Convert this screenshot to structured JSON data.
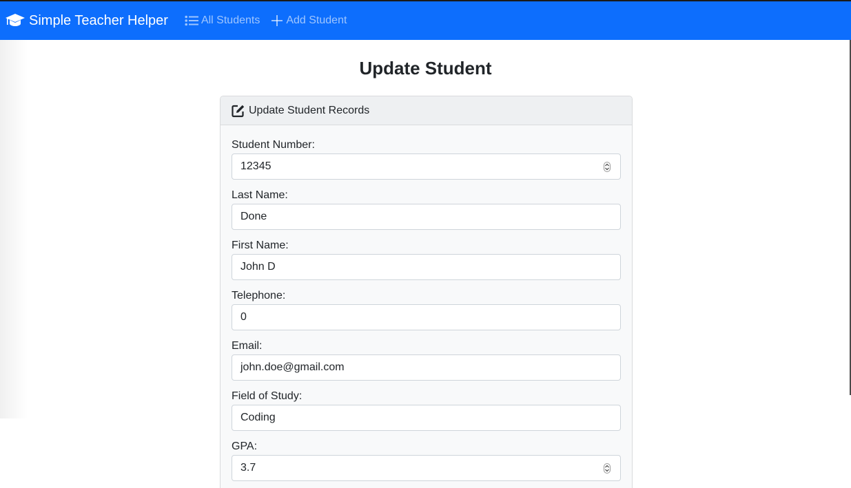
{
  "navbar": {
    "brand": "Simple Teacher Helper",
    "links": [
      {
        "label": "All Students",
        "icon": "list-icon"
      },
      {
        "label": "Add Student",
        "icon": "plus-icon"
      }
    ],
    "color": "#0d6efd"
  },
  "page": {
    "title": "Update Student"
  },
  "card": {
    "header": "Update Student Records",
    "fields": [
      {
        "label": "Student Number:",
        "value": "12345",
        "type": "number"
      },
      {
        "label": "Last Name:",
        "value": "Done",
        "type": "text"
      },
      {
        "label": "First Name:",
        "value": "John D",
        "type": "text"
      },
      {
        "label": "Telephone:",
        "value": "0",
        "type": "text"
      },
      {
        "label": "Email:",
        "value": "john.doe@gmail.com",
        "type": "text"
      },
      {
        "label": "Field of Study:",
        "value": "Coding",
        "type": "text"
      },
      {
        "label": "GPA:",
        "value": "3.7",
        "type": "number"
      }
    ]
  }
}
